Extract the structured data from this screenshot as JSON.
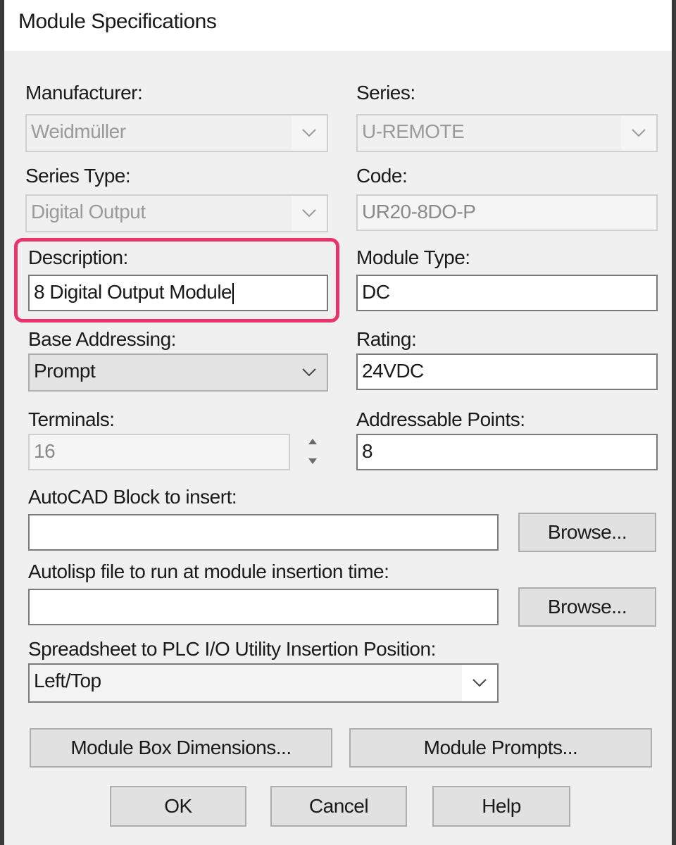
{
  "window": {
    "title": "Module Specifications"
  },
  "manufacturer": {
    "label": "Manufacturer:",
    "value": "Weidmüller"
  },
  "series": {
    "label": "Series:",
    "value": "U-REMOTE"
  },
  "series_type": {
    "label": "Series Type:",
    "value": "Digital Output"
  },
  "code": {
    "label": "Code:",
    "value": "UR20-8DO-P"
  },
  "description": {
    "label": "Description:",
    "value": "8 Digital Output Module"
  },
  "module_type": {
    "label": "Module Type:",
    "value": "DC"
  },
  "base_addressing": {
    "label": "Base Addressing:",
    "value": "Prompt"
  },
  "rating": {
    "label": "Rating:",
    "value": "24VDC"
  },
  "terminals": {
    "label": "Terminals:",
    "value": "16"
  },
  "addressable_points": {
    "label": "Addressable Points:",
    "value": "8"
  },
  "autocad_block": {
    "label": "AutoCAD Block to insert:",
    "value": "",
    "browse_label": "Browse..."
  },
  "autolisp_file": {
    "label": "Autolisp file to run at module insertion time:",
    "value": "",
    "browse_label": "Browse..."
  },
  "insertion_position": {
    "label": "Spreadsheet to PLC I/O Utility Insertion Position:",
    "value": "Left/Top"
  },
  "buttons": {
    "module_box_dimensions": "Module Box Dimensions...",
    "module_prompts": "Module Prompts...",
    "ok": "OK",
    "cancel": "Cancel",
    "help": "Help"
  },
  "colors": {
    "highlight": "#e8336b",
    "dialog_bg": "#f0f0f0"
  },
  "icons": {
    "dropdown": "chevron-down-icon",
    "spin_up": "arrow-up-icon",
    "spin_down": "arrow-down-icon"
  }
}
